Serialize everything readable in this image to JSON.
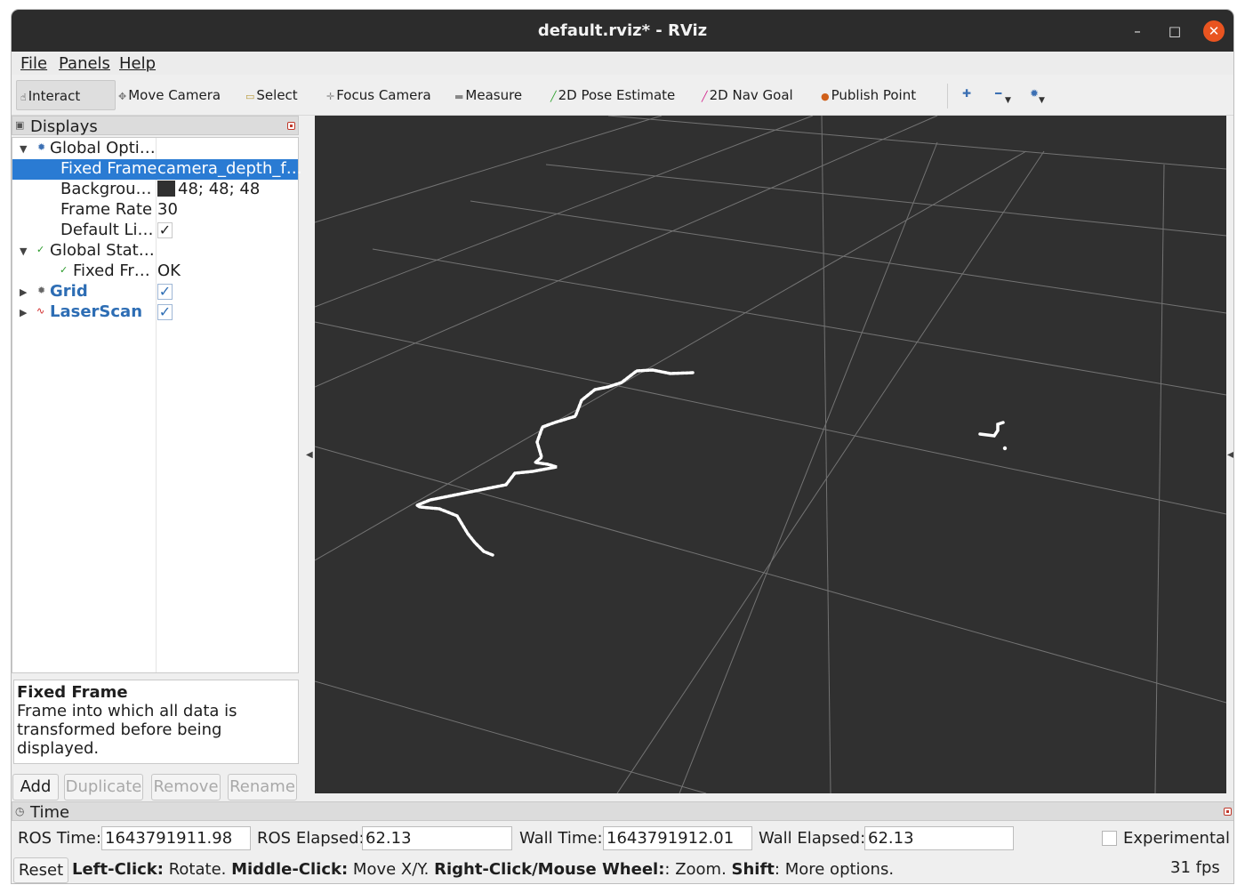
{
  "window": {
    "title": "default.rviz* - RViz",
    "minimize_glyph": "–",
    "maximize_glyph": "□",
    "close_glyph": "✕"
  },
  "menu": [
    "File",
    "Panels",
    "Help"
  ],
  "toolbar": {
    "tools": [
      {
        "label": "Interact",
        "icon": "hand-icon"
      },
      {
        "label": "Move Camera",
        "icon": "move-camera-icon"
      },
      {
        "label": "Select",
        "icon": "select-icon"
      },
      {
        "label": "Focus Camera",
        "icon": "focus-camera-icon"
      },
      {
        "label": "Measure",
        "icon": "measure-icon"
      },
      {
        "label": "2D Pose Estimate",
        "icon": "pose-estimate-icon"
      },
      {
        "label": "2D Nav Goal",
        "icon": "nav-goal-icon"
      },
      {
        "label": "Publish Point",
        "icon": "publish-point-icon"
      }
    ],
    "active_tool": "Interact"
  },
  "displays_panel": {
    "title": "Displays",
    "rows": [
      {
        "label": "Global Opti…",
        "value": ""
      },
      {
        "label": "Fixed Frame",
        "value": "camera_depth_f…"
      },
      {
        "label": "Backgrou…",
        "value": "48; 48; 48"
      },
      {
        "label": "Frame Rate",
        "value": "30"
      },
      {
        "label": "Default Li…",
        "value": "✓"
      },
      {
        "label": "Global Stat…",
        "value": ""
      },
      {
        "label": "Fixed Fr…",
        "value": "OK"
      },
      {
        "label": "Grid",
        "value": "✓"
      },
      {
        "label": "LaserScan",
        "value": "✓"
      }
    ],
    "background_color": "#303030",
    "description": {
      "title": "Fixed Frame",
      "line1": "Frame into which all data is",
      "line2": "transformed before being displayed."
    },
    "buttons": {
      "add": "Add",
      "duplicate": "Duplicate",
      "remove": "Remove",
      "rename": "Rename"
    }
  },
  "time_panel": {
    "title": "Time",
    "ros_time_label": "ROS Time:",
    "ros_time": "1643791911.98",
    "ros_elapsed_label": "ROS Elapsed:",
    "ros_elapsed": "62.13",
    "wall_time_label": "Wall Time:",
    "wall_time": "1643791912.01",
    "wall_elapsed_label": "Wall Elapsed:",
    "wall_elapsed": "62.13",
    "experimental_label": "Experimental"
  },
  "status": {
    "reset_label": "Reset",
    "left_click": "Left-Click:",
    "left_action": " Rotate. ",
    "middle_click": "Middle-Click:",
    "middle_action": " Move X/Y. ",
    "right_click": "Right-Click/Mouse Wheel:",
    "right_action": ": Zoom. ",
    "shift": "Shift",
    "shift_action": ": More options.",
    "fps": "31 fps"
  }
}
